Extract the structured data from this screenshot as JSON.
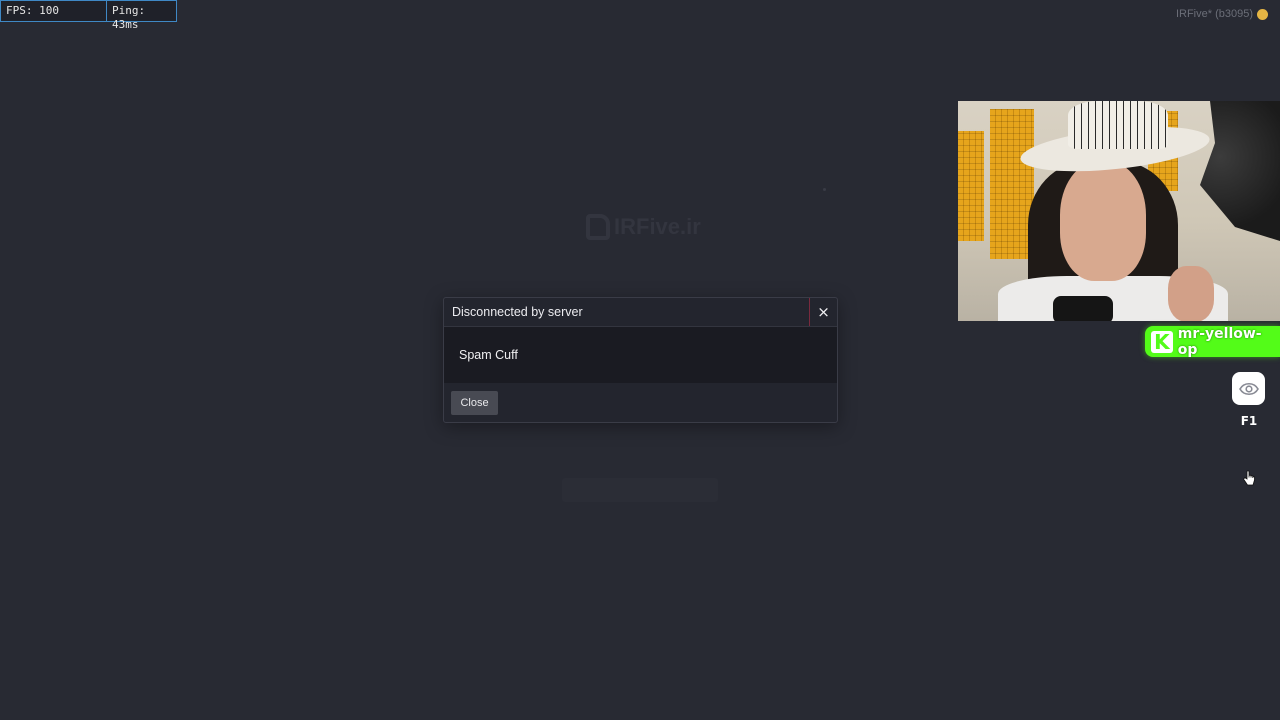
{
  "stats": {
    "fps": "FPS: 100",
    "ping": "Ping: 43ms"
  },
  "version": {
    "text": "IRFive* (b3095)"
  },
  "background": {
    "logo_text": "IRFive.ir"
  },
  "modal": {
    "title": "Disconnected by server",
    "close_icon": "×",
    "message": "Spam Cuff",
    "close_button": "Close"
  },
  "stream_overlay": {
    "platform_icon": "K",
    "username": "mr-yellow-op",
    "brand_color": "#53fc18",
    "eye_button_icon": "eye-icon",
    "hotkey_label": "F1"
  },
  "colors": {
    "background": "#282a33",
    "modal_body": "#1a1b22",
    "close_accent": "#7a2a3e",
    "stats_border": "#3f88c5"
  }
}
